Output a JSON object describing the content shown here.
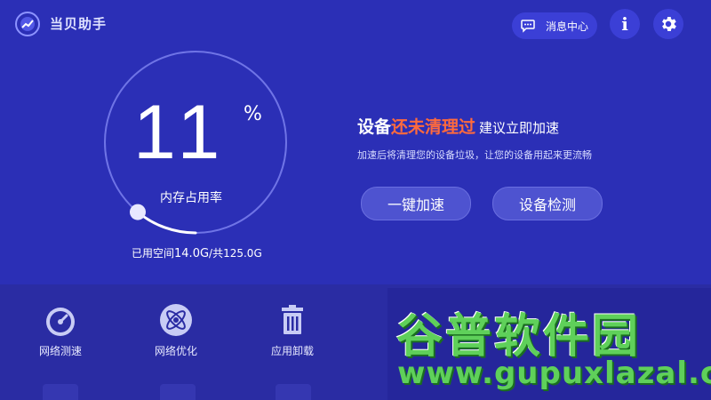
{
  "app": {
    "title": "当贝助手"
  },
  "header": {
    "messages_label": "消息中心"
  },
  "memory": {
    "percent": "11",
    "percent_unit": "%",
    "label": "内存占用率",
    "used_prefix": "已用空间",
    "used_value": "14.0G",
    "total_suffix": "/共125.0G",
    "usage_fraction": 0.11
  },
  "promo": {
    "head_prefix": "设备",
    "head_highlight": "还未清理过",
    "head_suffix": "建议立即加速",
    "subtext": "加速后将清理您的设备垃圾，让您的设备用起来更流畅",
    "boost_label": "一键加速",
    "check_label": "设备检测"
  },
  "tools": [
    {
      "label": "网络测速",
      "icon": "speedometer-icon"
    },
    {
      "label": "网络优化",
      "icon": "atom-icon"
    },
    {
      "label": "应用卸载",
      "icon": "trash-icon"
    }
  ],
  "watermark": {
    "big": "谷普软件园",
    "small": "www.gupuxlazal.com"
  },
  "colors": {
    "background": "#2b2fb6",
    "accent": "#ff6a3d",
    "button": "#4e53d0"
  }
}
